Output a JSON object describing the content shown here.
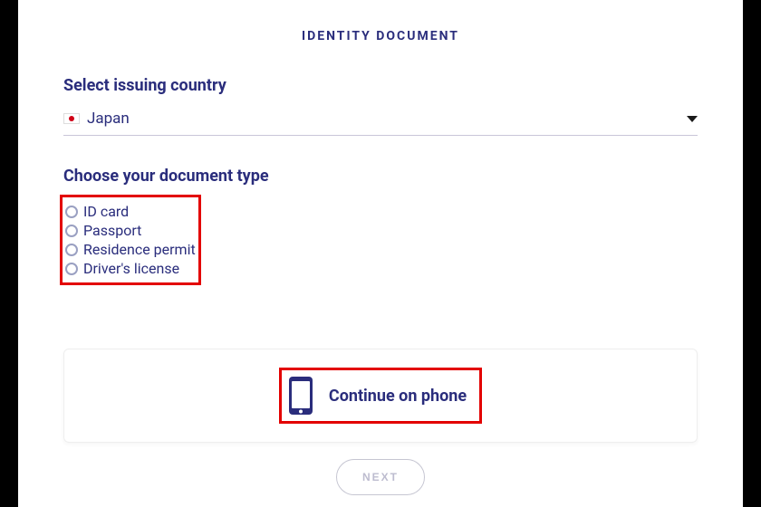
{
  "title": "IDENTITY DOCUMENT",
  "issuing": {
    "label": "Select issuing country",
    "value": "Japan",
    "flag": "japan-flag-icon"
  },
  "doctype": {
    "label": "Choose your document type",
    "options": [
      {
        "label": "ID card"
      },
      {
        "label": "Passport"
      },
      {
        "label": "Residence permit"
      },
      {
        "label": "Driver's license"
      }
    ]
  },
  "continue": {
    "label": "Continue on phone"
  },
  "next": {
    "label": "NEXT"
  }
}
